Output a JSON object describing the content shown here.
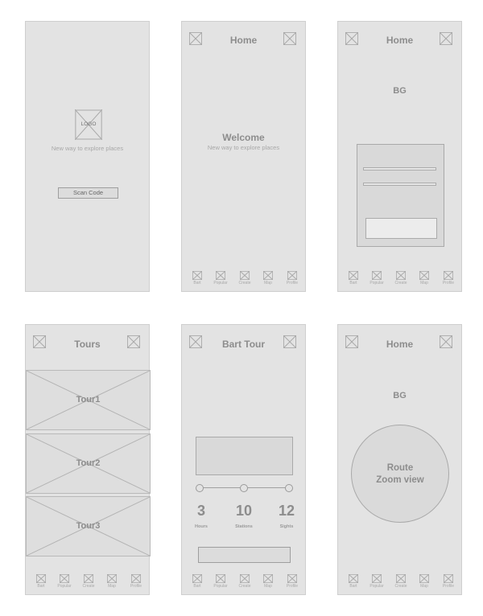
{
  "screens": {
    "splash": {
      "logo": "LOGO",
      "tagline": "New way to explore places",
      "scan_button": "Scan Code"
    },
    "welcome": {
      "header_title": "Home",
      "welcome_title": "Welcome",
      "tagline": "New way to explore places"
    },
    "home_bg": {
      "header_title": "Home",
      "bg_label": "BG"
    },
    "tours": {
      "header_title": "Tours",
      "items": [
        "Tour1",
        "Tour2",
        "Tour3"
      ]
    },
    "bart_tour": {
      "header_title": "Bart Tour",
      "progress_steps": 3,
      "stats": [
        {
          "value": "3",
          "label": "Hours"
        },
        {
          "value": "10",
          "label": "Stations"
        },
        {
          "value": "12",
          "label": "Sights"
        }
      ]
    },
    "route": {
      "header_title": "Home",
      "bg_label": "BG",
      "route_line1": "Route",
      "route_line2": "Zoom view"
    }
  },
  "bottom_nav": [
    "Bart",
    "Popular",
    "Create",
    "Map",
    "Profile"
  ],
  "colors": {
    "screen_bg": "#e3e3e3",
    "placeholder_stroke": "#a9a9a9",
    "text": "#8d8d8d"
  }
}
